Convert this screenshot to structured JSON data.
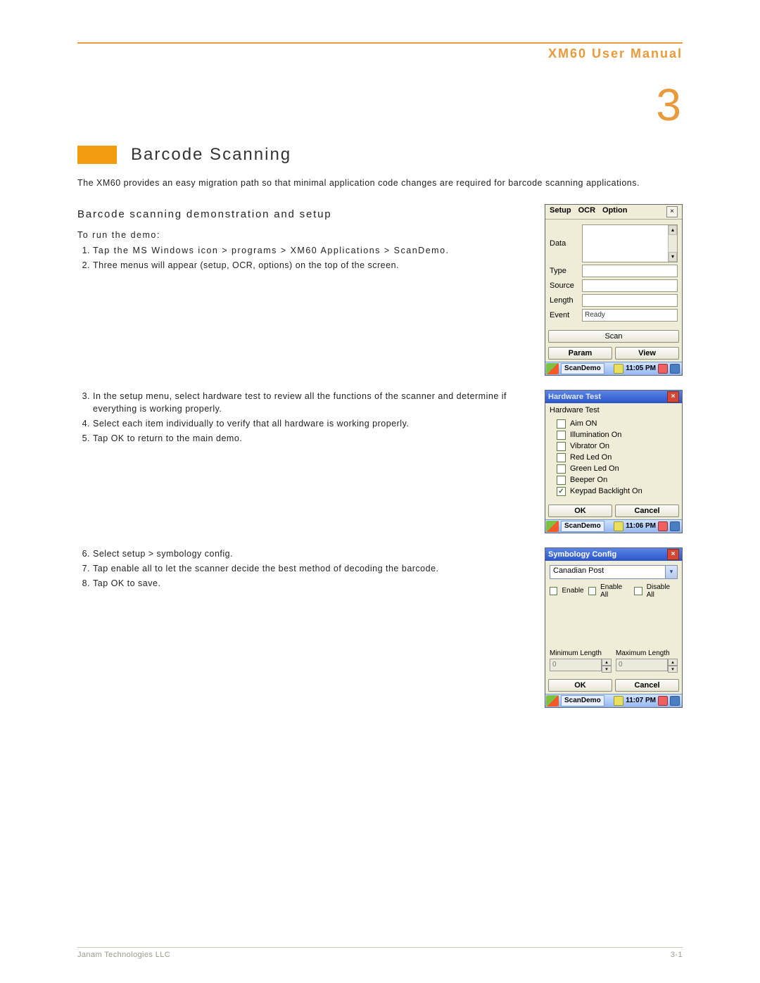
{
  "doc": {
    "title": "XM60 User Manual",
    "chapter_number": "3",
    "chapter_title": "Barcode Scanning",
    "intro": "The XM60 provides an easy migration path so that minimal application code changes are required for barcode scanning applications.",
    "subhead": "Barcode scanning demonstration and setup",
    "run_label": "To run the demo:",
    "steps_a": [
      "Tap the MS Windows icon > programs > XM60 Applications > ScanDemo.",
      "Three menus will appear (setup, OCR, options) on the top of the screen."
    ],
    "steps_b": [
      "In the setup menu, select hardware test to review all the functions of the scanner and determine if everything is working properly.",
      "Select each item individually to verify that all hardware is working properly.",
      "Tap OK to return to the main demo."
    ],
    "steps_c": [
      "Select setup > symbology config.",
      "Tap enable all to let the scanner decide the best method of decoding the barcode.",
      "Tap OK to save."
    ]
  },
  "scandemo": {
    "menus": {
      "setup": "Setup",
      "ocr": "OCR",
      "option": "Option"
    },
    "labels": {
      "data": "Data",
      "type": "Type",
      "source": "Source",
      "length": "Length",
      "event": "Event"
    },
    "event_value": "Ready",
    "buttons": {
      "scan": "Scan",
      "param": "Param",
      "view": "View"
    },
    "taskbar": {
      "app": "ScanDemo",
      "time": "11:05 PM"
    }
  },
  "hwtest": {
    "title": "Hardware Test",
    "header": "Hardware Test",
    "items": [
      {
        "label": "Aim ON",
        "checked": false
      },
      {
        "label": "Illumination On",
        "checked": false
      },
      {
        "label": "Vibrator On",
        "checked": false
      },
      {
        "label": "Red Led On",
        "checked": false
      },
      {
        "label": "Green Led On",
        "checked": false
      },
      {
        "label": "Beeper On",
        "checked": false
      },
      {
        "label": "Keypad Backlight On",
        "checked": true
      }
    ],
    "ok": "OK",
    "cancel": "Cancel",
    "taskbar": {
      "app": "ScanDemo",
      "time": "11:06 PM"
    }
  },
  "symconfig": {
    "title": "Symbology Config",
    "combo_value": "Canadian Post",
    "enable": "Enable",
    "enable_all": "Enable All",
    "disable_all": "Disable All",
    "min_label": "Minimum Length",
    "max_label": "Maximum Length",
    "min_value": "0",
    "max_value": "0",
    "ok": "OK",
    "cancel": "Cancel",
    "taskbar": {
      "app": "ScanDemo",
      "time": "11:07 PM"
    }
  },
  "footer": {
    "company": "Janam Technologies LLC",
    "page": "3-1"
  }
}
